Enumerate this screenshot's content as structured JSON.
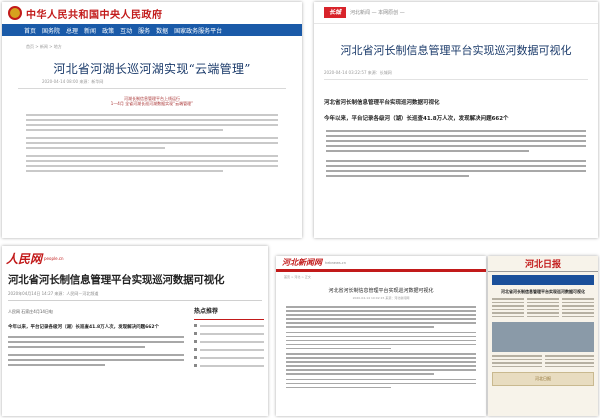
{
  "colors": {
    "gov_red": "#c21a1a",
    "gov_nav_blue": "#1a5aa8",
    "title_blue": "#1a3a6a",
    "hebnews_red": "#d8232a",
    "paper_blue": "#1a4f9a"
  },
  "gov": {
    "site_name": "中华人民共和国中央人民政府",
    "nav": [
      "首页",
      "国务院",
      "总理",
      "新闻",
      "政策",
      "互动",
      "服务",
      "数据",
      "国家政务服务平台"
    ],
    "breadcrumb": "首页 > 新闻 > 地方",
    "title": "河北省河湖长巡河湖实现“云端管理”",
    "meta": "2020-04-14 08:00  来源：新华网",
    "lead": [
      "河湖长制信息管理平台上线运行",
      "1—4月 全省河湖长巡河湖数据实现“云端管理”"
    ]
  },
  "hebnews": {
    "logo": "长城",
    "logo_sub": "河北新闻 — 本网原创 —",
    "title": "河北省河长制信息管理平台实现巡河数据可视化",
    "meta": "2020-04-14 03:22:57  来源：长城网",
    "subtitle": "河北省河长制信息管理平台实现巡河数据可视化",
    "lead": "今年以来，平台记录各级河（湖）长巡查41.8万人次，发现解决问题662个"
  },
  "people": {
    "logo": "人民网",
    "logo_sub": "people.cn",
    "title": "河北省河长制信息管理平台实现巡河数据可视化",
    "meta": "2020年04月14日 14:27  来源：人民网－河北频道",
    "source_line": "人民网 石家庄4月14日电",
    "lead": "今年以来，平台记录各级河（湖）长巡查41.8万人次，发现解决问题662个",
    "side_title": "热点推荐"
  },
  "hebei_news": {
    "logo": "河北新闻网",
    "logo_sub": "hebnews.cn",
    "breadcrumb": "首页 > 河北 > 正文",
    "title": "河北省河长制信息管理平台实现巡河数据可视化",
    "meta": "2020-04-14 10:02:15  来源：河北新闻网"
  },
  "newspaper": {
    "masthead": "河北日报",
    "headline": "河北省河长制信息管理平台实现巡河数据可视化",
    "ad": "河北日报"
  }
}
